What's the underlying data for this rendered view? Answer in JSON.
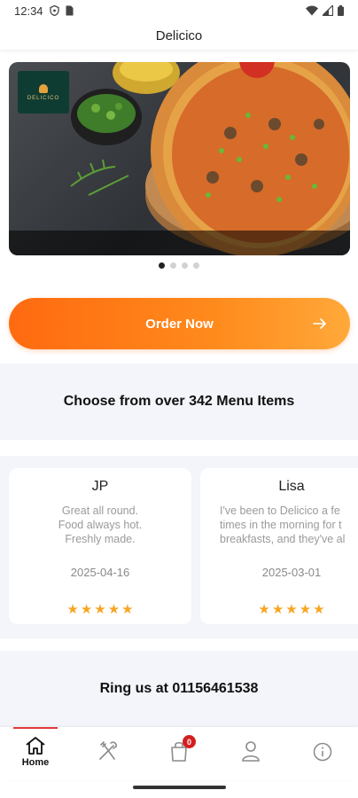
{
  "status_bar": {
    "time": "12:34"
  },
  "app_bar": {
    "title": "Delicico"
  },
  "carousel": {
    "logo_text": "DELICICO",
    "slide_count": 4,
    "active_slide": 1
  },
  "order": {
    "label": "Order Now"
  },
  "menu": {
    "headline": "Choose from over 342 Menu Items"
  },
  "reviews": [
    {
      "name": "JP",
      "lines": [
        "Great all round.",
        "Food always hot.",
        "Freshly made."
      ],
      "date": "2025-04-16",
      "rating": 5
    },
    {
      "name": "Lisa",
      "lines": [
        "I've been to Delicico a fe",
        "times in the morning for t",
        "breakfasts, and they've al"
      ],
      "date": "2025-03-01",
      "rating": 5
    }
  ],
  "contact": {
    "text": "Ring us at 01156461538"
  },
  "nav": {
    "items": [
      {
        "label": "Home",
        "icon": "home-icon",
        "active": true
      },
      {
        "label": "",
        "icon": "menu-utensils-icon",
        "active": false
      },
      {
        "label": "",
        "icon": "cart-bag-icon",
        "active": false,
        "badge": "0"
      },
      {
        "label": "",
        "icon": "account-icon",
        "active": false
      },
      {
        "label": "",
        "icon": "info-icon",
        "active": false
      }
    ]
  },
  "colors": {
    "accent": "#ff7a18",
    "star": "#f6a623",
    "badge": "#d21f1f",
    "section_bg": "#f3f5fa"
  }
}
